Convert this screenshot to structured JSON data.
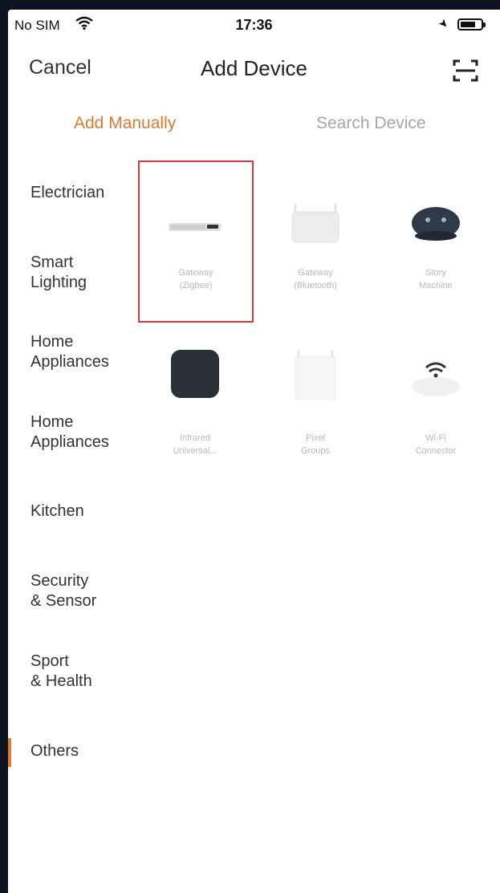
{
  "status_bar": {
    "carrier": "No SIM",
    "time": "17:36"
  },
  "nav": {
    "cancel_label": "Cancel",
    "title": "Add Device",
    "scan_icon": "scan-icon"
  },
  "tabs": [
    {
      "label": "Add Manually",
      "active": true
    },
    {
      "label": "Search Device",
      "active": false
    }
  ],
  "sidebar": {
    "items": [
      {
        "label": "Electrician"
      },
      {
        "label": "Smart\nLighting"
      },
      {
        "label": "Home\nAppliances"
      },
      {
        "label": "Home\nAppliances"
      },
      {
        "label": "Kitchen"
      },
      {
        "label": "Security\n& Sensor"
      },
      {
        "label": "Sport\n& Health"
      },
      {
        "label": "Others",
        "active": true
      }
    ]
  },
  "devices": [
    {
      "label": "Gateway\n(Zigbee)",
      "icon": "zigbee-gateway-icon",
      "selected": true
    },
    {
      "label": "Gateway\n(Bluetooth)",
      "icon": "bluetooth-gateway-icon"
    },
    {
      "label": "Story\nMachine",
      "icon": "story-machine-icon"
    },
    {
      "label": "Infrared\nUniversal...",
      "icon": "infrared-remote-icon"
    },
    {
      "label": "Pixel\nGroups",
      "icon": "pixel-groups-icon"
    },
    {
      "label": "Wi-Fi\nConnector",
      "icon": "wifi-connector-icon"
    }
  ],
  "colors": {
    "accent": "#e07a2f",
    "selection_border": "#d23b3b",
    "muted_text": "#a6a6a6"
  }
}
